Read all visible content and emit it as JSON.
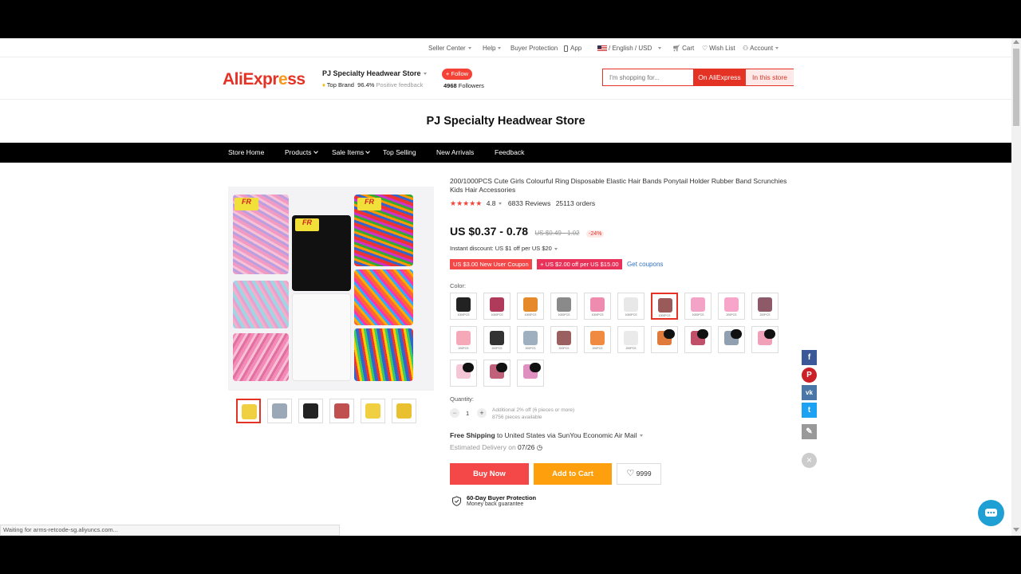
{
  "topbar": {
    "seller_center": "Seller Center",
    "help": "Help",
    "buyer_protection": "Buyer Protection",
    "app": "App",
    "locale": "/ English / USD",
    "cart": "Cart",
    "wish_list": "Wish List",
    "account": "Account"
  },
  "header": {
    "logo_text_a": "AliExpr",
    "logo_text_b": "e",
    "logo_text_c": "ss",
    "store_name": "PJ Specialty Headwear Store",
    "top_brand": "Top Brand",
    "positive_pct": "96.4%",
    "positive_label": "Positive feedback",
    "follow_label": "+ Follow",
    "followers_count": "4968",
    "followers_label": "Followers",
    "search_placeholder": "I'm shopping for...",
    "search_ae": "On AliExpress",
    "search_store": "In this store"
  },
  "page_title": "PJ Specialty Headwear Store",
  "nav": {
    "home": "Store Home",
    "products": "Products",
    "sale": "Sale Items",
    "top": "Top Selling",
    "arrivals": "New Arrivals",
    "feedback": "Feedback"
  },
  "product": {
    "title": "200/1000PCS Cute Girls Colourful Ring Disposable Elastic Hair Bands Ponytail Holder Rubber Band Scrunchies Kids Hair Accessories",
    "rating": "4.8",
    "reviews": "6833 Reviews",
    "orders": "25113 orders",
    "price": "US $0.37 - 0.78",
    "old_price": "US $0.49 - 1.02",
    "discount": "-24%",
    "instant_discount": "Instant discount: US $1 off per US $20",
    "coupon_1": "US $3.00 New User Coupon",
    "coupon_2": "+ US $2.00 off per US $15.00",
    "get_coupons": "Get coupons",
    "color_label": "Color:",
    "quantity_label": "Quantity:",
    "quantity": "1",
    "qty_note_1": "Additional 2% off (6 pieces or more)",
    "qty_note_2": "8756 pieces available",
    "free_shipping": "Free Shipping",
    "shipping_rest": "to United States via SunYou Economic Air Mail",
    "delivery_label": "Estimated Delivery on",
    "delivery_date": "07/26",
    "buy_now": "Buy Now",
    "add_to_cart": "Add to Cart",
    "wish_count": "9999",
    "protection_title": "60-Day Buyer Protection",
    "protection_sub": "Money back guarantee",
    "brand_tag": "FR",
    "swatches": [
      {
        "color": "#222222",
        "label": "1000PCS"
      },
      {
        "color": "#b03a5a",
        "label": "1000PCS"
      },
      {
        "color": "#e6892a",
        "label": "1000PCS"
      },
      {
        "color": "#8a8a8a",
        "label": "1000PCS"
      },
      {
        "color": "#f08bb0",
        "label": "1000PCS"
      },
      {
        "color": "#e8e8e8",
        "label": "1000PCS"
      },
      {
        "color": "#9a5a5a",
        "label": "1000PCS"
      },
      {
        "color": "#f3a3c6",
        "label": "1000PCS"
      },
      {
        "color": "#f7a6c9",
        "label": "200PCS"
      },
      {
        "color": "#8e5a6a",
        "label": "200PCS"
      },
      {
        "color": "#f5a8b8",
        "label": "200PCS"
      },
      {
        "color": "#333333",
        "label": "200PCS"
      },
      {
        "color": "#9eb0c0",
        "label": "200PCS"
      },
      {
        "color": "#9a6060",
        "label": "200PCS"
      },
      {
        "color": "#f08a40",
        "label": "200PCS"
      },
      {
        "color": "#eaeaea",
        "label": "200PCS"
      },
      {
        "color": "#e07a3a",
        "label": ""
      },
      {
        "color": "#c0506a",
        "label": ""
      },
      {
        "color": "#90a0b0",
        "label": ""
      },
      {
        "color": "#f0a0b8",
        "label": ""
      },
      {
        "color": "#f5c6d6",
        "label": ""
      },
      {
        "color": "#c0607a",
        "label": ""
      },
      {
        "color": "#e090c0",
        "label": ""
      }
    ],
    "thumb_colors": [
      "#f0d040",
      "#9aa8b8",
      "#222222",
      "#c05050",
      "#f0d040",
      "#e8c030"
    ]
  },
  "social": {
    "facebook": "f",
    "pinterest": "P",
    "vk": "vk",
    "twitter": "t",
    "edit": "✎",
    "close": "×"
  },
  "status_bar": "Waiting for arms-retcode-sg.aliyuncs.com..."
}
